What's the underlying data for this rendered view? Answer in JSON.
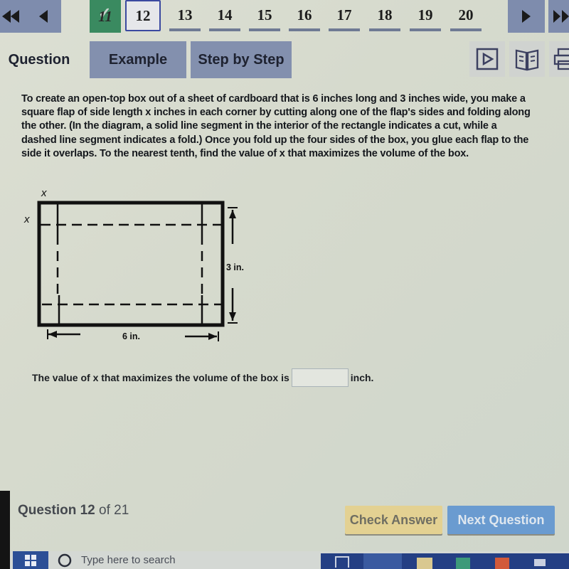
{
  "nav": {
    "first_label": "first-question",
    "prev_label": "previous-question",
    "questions": [
      {
        "label": "11",
        "state": "done"
      },
      {
        "label": "12",
        "state": "current"
      },
      {
        "label": "13",
        "state": "pending"
      },
      {
        "label": "14",
        "state": "pending"
      },
      {
        "label": "15",
        "state": "pending"
      },
      {
        "label": "16",
        "state": "pending"
      },
      {
        "label": "17",
        "state": "pending"
      },
      {
        "label": "18",
        "state": "pending"
      },
      {
        "label": "19",
        "state": "pending"
      },
      {
        "label": "20",
        "state": "pending"
      }
    ]
  },
  "tabs": {
    "question": "Question",
    "example": "Example",
    "step_by_step": "Step by Step"
  },
  "toolbar_icons": [
    "play-video-icon",
    "open-book-icon",
    "print-icon"
  ],
  "problem": {
    "text": "To create an open-top box out of a sheet of cardboard that is 6 inches long and 3 inches wide, you make a square flap of side length x inches in each corner by cutting along one of the flap's sides and folding along the other. (In the diagram, a solid line segment in the interior of the rectangle indicates a cut, while a dashed line segment indicates a fold.) Once you fold up the four sides of the box, you glue each flap to the side it overlaps. To the nearest tenth, find the value of x that maximizes the volume of the box.",
    "diagram": {
      "label_x_top": "x",
      "label_x_left": "x",
      "label_height": "3 in.",
      "label_width": "6 in."
    },
    "answer_prefix": "The value of x that maximizes the volume of the box is",
    "answer_value": "",
    "answer_suffix": "inch."
  },
  "footer": {
    "question_word": "Question 12",
    "of_text": "of 21",
    "check_answer": "Check Answer",
    "next_question": "Next Question"
  },
  "taskbar": {
    "search_placeholder": "Type here to search"
  },
  "colors": {
    "nav_button": "#7e8cad",
    "done_question": "#3a8a60",
    "current_border": "#3b49a0",
    "check_button": "#e3d192",
    "next_button": "#6a9bd0",
    "taskbar": "#243f84"
  }
}
